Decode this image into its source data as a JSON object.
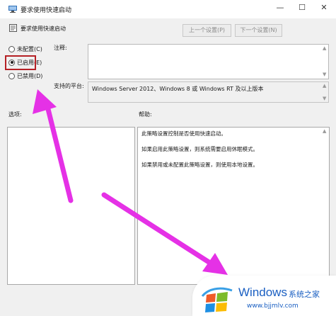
{
  "window": {
    "title": "要求使用快速启动",
    "controls": {
      "minimize": "—",
      "maximize": "☐",
      "close": "✕"
    }
  },
  "header": {
    "policy_name": "要求使用快速启动",
    "prev_button": "上一个设置(P)",
    "next_button": "下一个设置(N)"
  },
  "radio_options": [
    {
      "label": "未配置(C)",
      "selected": false
    },
    {
      "label": "已启用(E)",
      "selected": true
    },
    {
      "label": "已禁用(D)",
      "selected": false
    }
  ],
  "comment": {
    "label": "注释:",
    "value": ""
  },
  "supported": {
    "label": "支持的平台:",
    "value": "Windows Server 2012、Windows 8 或 Windows RT 及以上版本"
  },
  "options": {
    "label": "选项:"
  },
  "help": {
    "label": "帮助:",
    "lines": [
      "此策略设置控制是否使用快速启动。",
      "如果启用此策略设置，则系统需要启用休眠模式。",
      "如果禁用或未配置此策略设置，则使用本地设置。"
    ]
  },
  "watermark": {
    "brand": "Windows",
    "site_name": "系统之家",
    "url": "www.bjjmlv.com"
  },
  "colors": {
    "annotation_arrow": "#e531e6",
    "highlight_box": "#b52025",
    "watermark_blue": "#1a5fc2"
  }
}
